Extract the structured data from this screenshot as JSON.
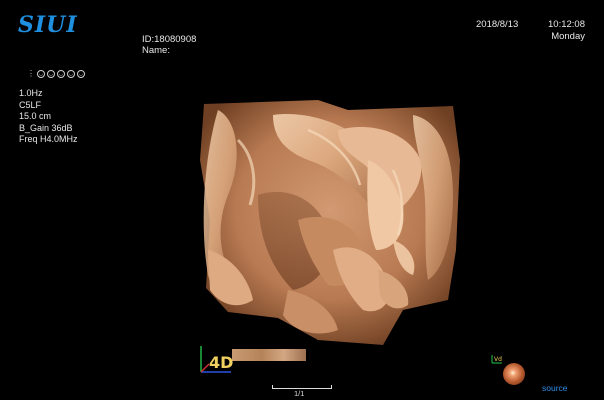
{
  "header": {
    "logo": "SIUI",
    "patient_id": "ID:18080908",
    "patient_name": "Name:",
    "date": "2018/8/13",
    "time": "10:12:08",
    "weekday": "Monday"
  },
  "toolbar_icons": [
    "probe-icon",
    "face-1-icon",
    "face-2-icon",
    "face-3-icon",
    "face-4-icon",
    "face-5-icon"
  ],
  "parameters": [
    "1.0Hz",
    "C5LF",
    "15.0 cm",
    "B_Gain 36dB",
    "Freq H4.0MHz"
  ],
  "viewer": {
    "page_indicator": "1/1",
    "source_label": "source"
  },
  "colors": {
    "logo": "#1f8fe0",
    "tissue_light": "#e4b48e",
    "tissue_mid": "#c48862",
    "tissue_dark": "#7c4c2c",
    "link": "#2f8de8"
  }
}
